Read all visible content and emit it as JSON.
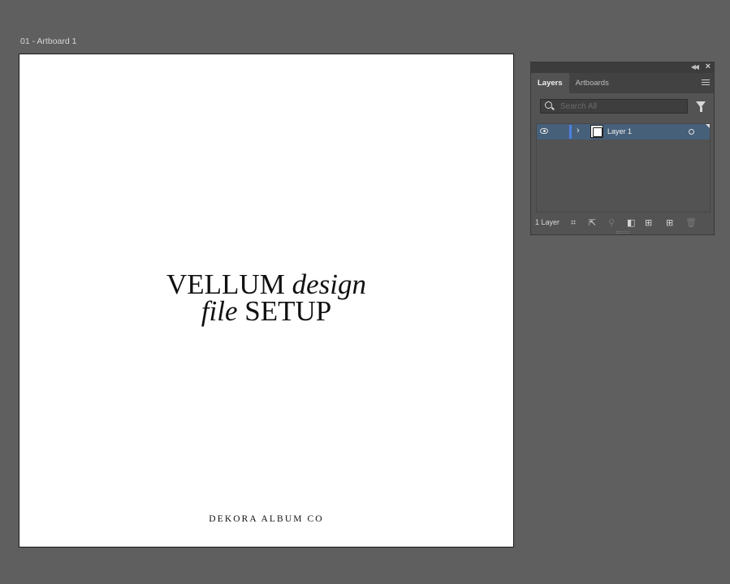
{
  "artboard": {
    "label": "01 - Artboard 1",
    "heading_line1_roman": "VELLUM ",
    "heading_line1_italic": "design",
    "heading_line2_italic": "file",
    "heading_line2_roman": " SETUP",
    "footer": "DEKORA ALBUM CO"
  },
  "panel": {
    "tabs": [
      {
        "label": "Layers",
        "active": true
      },
      {
        "label": "Artboards",
        "active": false
      }
    ],
    "search_placeholder": "Search All",
    "layers": [
      {
        "name": "Layer 1",
        "visible": true,
        "color": "#4d7fe0"
      }
    ],
    "layer_count": "1 Layer",
    "icons": [
      "collapse-icon",
      "close-icon",
      "panel-menu-icon",
      "search-icon",
      "filter-icon",
      "eye-icon",
      "chevron-right-icon",
      "target-icon",
      "collect-for-export-icon",
      "export-icon",
      "locate-object-icon",
      "make-clipping-mask-icon",
      "create-sublayer-icon",
      "create-layer-icon",
      "trash-icon"
    ]
  },
  "colors": {
    "workspace": "#5f5f5f",
    "panel": "#535353",
    "selected_row": "#46607a",
    "layer_color": "#4d7fe0"
  }
}
